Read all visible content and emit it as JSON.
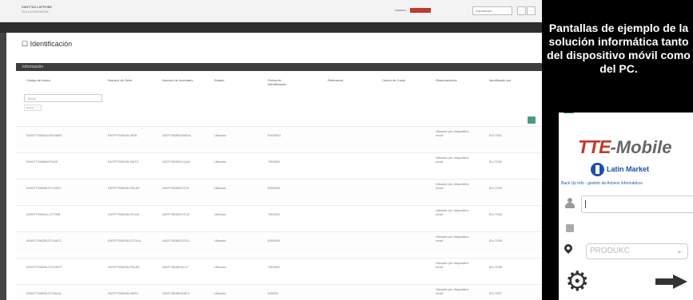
{
  "pc": {
    "title_line1": "SANTTAS LAPROBE",
    "title_line2": "SOLUCION MOVIL",
    "header_label": "Usuario:",
    "header_select_value": "Liquidacion",
    "module_title": "Identificación",
    "section_title": "Información",
    "columns": [
      "Código de Activo",
      "Número de Serie",
      "Número de Inventario",
      "Estado",
      "Fecha de Identificación",
      "Referencia",
      "Centro de Costo",
      "Observaciones",
      "Identificado por"
    ],
    "filter_value": "Todos",
    "filter_small": "Buscar",
    "rows": [
      [
        "0000TTSMDDUXSLMBS",
        "EMTPT5000SLXEIS",
        "UEIF73D5ED0M1IA",
        "Ubicado",
        "ID0/5001",
        "",
        "",
        "Ubicado por dispositivo movil",
        "ID:LT001"
      ],
      [
        "0000TTSMIMASTAS5",
        "EMTPT5000SLSMTC",
        "UEIF73D5ED1UAA",
        "Ubicado",
        "TID0500",
        "",
        "",
        "Ubicado por dispositivo movil",
        "ID:LT002"
      ],
      [
        "0000TTSMDEUTCHATC",
        "EMTPT5000SLTELAP",
        "UEIF73D5ED2TLE",
        "Ubicado",
        "ID0500A",
        "",
        "",
        "Ubicado por dispositivo movil",
        "ID:LT003"
      ],
      [
        "0000TTSM0JLLOTTMB",
        "EMTPT5000SL0TUOL",
        "UEIF73D5ED0TLR",
        "Ubicado",
        "TID0500",
        "",
        "",
        "Ubicado por dispositivo movil",
        "ID:LT004"
      ],
      [
        "0000TTSMDEUTCHATC",
        "EMTPT5000SL0TCLAL",
        "UEIF73D5ED3TLD",
        "Ubicado",
        "ID0500A",
        "",
        "",
        "Ubicado por dispositivo movil",
        "ID:LT005"
      ],
      [
        "0000TTSMDEUTCHSOT",
        "EMTPT5000SLTELAP",
        "UEIF73D5ED4LLT",
        "Ubicado",
        "TID0500",
        "",
        "",
        "Ubicado por dispositivo movil",
        "ID:LT006"
      ],
      [
        "0000TTSMDEUTCMLAL",
        "EMTPT5000SL0MTC",
        "UEIF73D5ED5AFC",
        "Ubicado",
        "ID0500",
        "",
        "",
        "Ubicado por dispositivo movil",
        "ID:LT007"
      ]
    ]
  },
  "caption": "Pantallas de ejemplo de la solución informática tanto del dispositivo móvil como del PC.",
  "phone": {
    "logo_main": "TTE",
    "logo_suffix": "-Mobile",
    "brand_name": "Latin Market",
    "brand_tagline": "Back Up Info - gestión de Activos informáticos",
    "select_placeholder": "PRODUKC",
    "select_chevron": "⌄",
    "gear_glyph": "⚙"
  },
  "colors": {
    "accent_red": "#c0392b",
    "band_dark": "#2e2e2e",
    "green_button": "#4b9a7d",
    "brand_blue": "#1f4fa8"
  }
}
